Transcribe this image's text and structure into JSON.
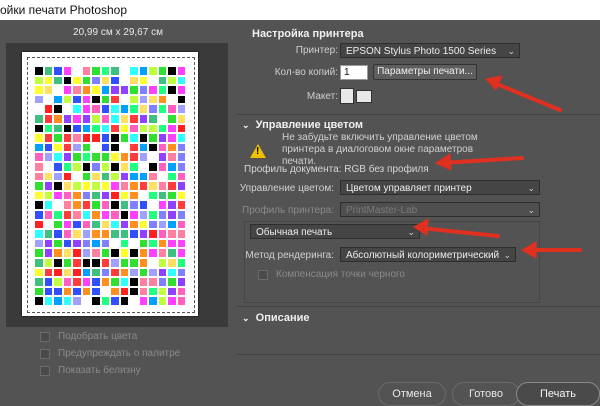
{
  "window": {
    "title": "ойки печати Photoshop"
  },
  "preview": {
    "dimensions": "20,99 см x 29,67 см",
    "swatch_colors": [
      "#ff3b3b",
      "#30e030",
      "#3050ff",
      "#ffff30",
      "#ff40ff",
      "#30ffff",
      "#ff9020",
      "#9040ff",
      "#ffffff",
      "#000000",
      "#ff80a0",
      "#40c080",
      "#a0a0ff",
      "#c0ff40",
      "#ff60c0",
      "#00a0ff",
      "#ff2020",
      "#20ff80",
      "#8080ff",
      "#ffe060"
    ]
  },
  "left_options": [
    {
      "label": "Подобрать цвета"
    },
    {
      "label": "Предупреждать о палитре"
    },
    {
      "label": "Показать белизну"
    }
  ],
  "printer_section": {
    "title": "Настройка принтера",
    "printer_label": "Принтер:",
    "printer_value": "EPSON Stylus Photo 1500 Series",
    "copies_label": "Кол-во копий:",
    "copies_value": "1",
    "print_settings_button": "Параметры печати...",
    "layout_label": "Макет:"
  },
  "color_section": {
    "title": "Управление цветом",
    "warning": "Не забудьте включить управление цветом принтера в диалоговом окне параметров печати.",
    "document_profile": "Профиль документа: RGB без профиля",
    "color_handling_label": "Управление цветом:",
    "color_handling_value": "Цветом управляет принтер",
    "printer_profile_label": "Профиль принтера:",
    "printer_profile_value": "PrintMaster-Lab",
    "normal_print_value": "Обычная печать",
    "rendering_label": "Метод рендеринга:",
    "rendering_value": "Абсолютный колориметрический",
    "black_point_label": "Компенсация точки черного"
  },
  "description_section": {
    "title": "Описание"
  },
  "buttons": {
    "cancel": "Отмена",
    "done": "Готово",
    "print": "Печать"
  },
  "colors": {
    "arrow": "#e03020",
    "warning": "#f0c000"
  }
}
